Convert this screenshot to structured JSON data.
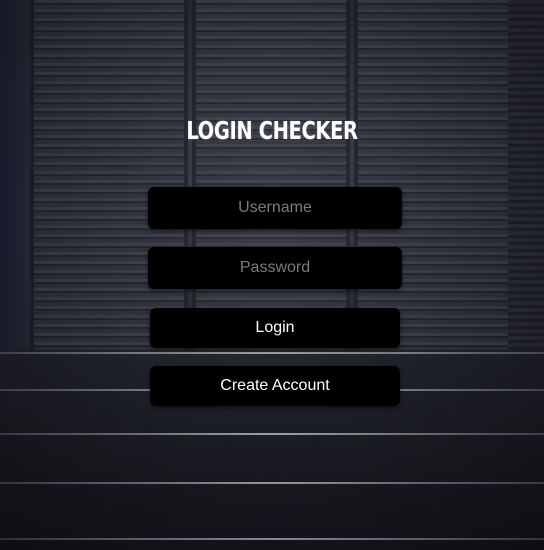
{
  "form": {
    "title": "LOGIN CHECKER",
    "username_placeholder": "Username",
    "username_value": "",
    "password_placeholder": "Password",
    "password_value": "",
    "login_label": "Login",
    "create_account_label": "Create Account"
  },
  "colors": {
    "input_background": "#000000",
    "button_background": "#000000",
    "text": "#ffffff",
    "placeholder": "#7b7b7b"
  }
}
